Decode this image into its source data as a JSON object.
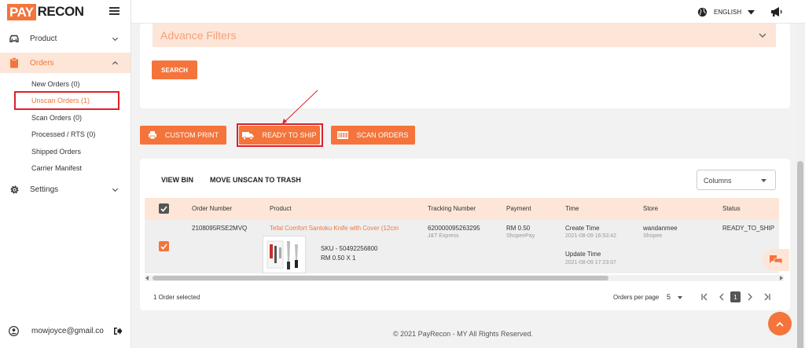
{
  "brand": {
    "part1": "PAY",
    "part2": "RECON"
  },
  "sidebar": {
    "items": [
      {
        "label": "Product",
        "icon": "car-icon"
      },
      {
        "label": "Orders",
        "icon": "clipboard-icon"
      },
      {
        "label": "Settings",
        "icon": "gear-icon"
      }
    ],
    "orders_sub": [
      "New Orders (0)",
      "Unscan Orders (1)",
      "Scan Orders (0)",
      "Processed / RTS (0)",
      "Shipped Orders",
      "Carrier Manifest"
    ],
    "user_email": "mowjoyce@gmail.co"
  },
  "topbar": {
    "language": "ENGLISH"
  },
  "filters": {
    "advance_label": "Advance Filters",
    "search_button": "SEARCH"
  },
  "toolbar": {
    "custom_print": "CUSTOM PRINT",
    "ready_to_ship": "READY TO SHIP",
    "scan_orders": "SCAN ORDERS"
  },
  "table": {
    "actions": {
      "view_bin": "VIEW BIN",
      "move_unscan": "MOVE UNSCAN TO TRASH"
    },
    "columns_select": "Columns",
    "headers": [
      "Order Number",
      "Product",
      "Tracking Number",
      "Payment",
      "Time",
      "Store",
      "Status"
    ],
    "row": {
      "order_number": "2108095RSE2MVQ",
      "product_name": "Tefal Comfort Santoku Knife with Cover (12cm",
      "sku": "SKU - 50492256800",
      "price_qty": "RM 0.50 X 1",
      "tracking_number": "620000095263295",
      "carrier": "J&T Express",
      "payment": "RM 0.50",
      "payment_method": "ShopeePay",
      "create_time_label": "Create Time",
      "create_time": "2021-08-09 16:53:42",
      "update_time_label": "Update Time",
      "update_time": "2021-08-09 17:23:07",
      "store": "wandanmee",
      "platform": "Shopee",
      "status": "READY_TO_SHIP"
    },
    "selected_text": "1 Order selected",
    "pagination": {
      "per_page_label": "Orders per page",
      "per_page": "5",
      "current_page": "1"
    }
  },
  "footer": "© 2021 PayRecon - MY All Rights Reserved.",
  "colors": {
    "accent": "#f4743b",
    "accent_light": "#fde6d8",
    "highlight_box": "#e0202a"
  }
}
